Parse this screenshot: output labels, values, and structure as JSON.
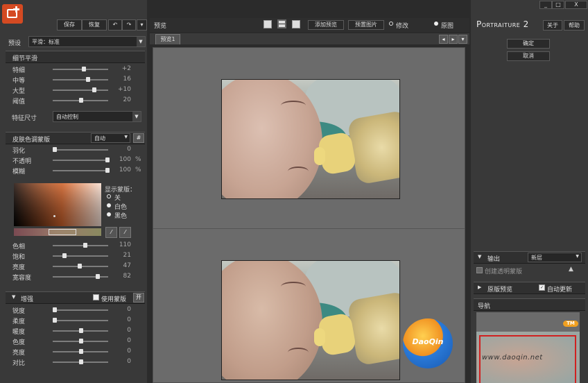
{
  "window": {
    "controls": [
      "_",
      "□",
      "X"
    ]
  },
  "toolbar": {
    "save": "保存",
    "restore": "恢复",
    "undo": "↶",
    "redo": "↷",
    "menu": "▾"
  },
  "preset": {
    "label": "预设",
    "value": "平滑：标准"
  },
  "detail": {
    "title": "细节平滑",
    "sliders": [
      {
        "label": "特细",
        "value": "+2",
        "pos": 0.55
      },
      {
        "label": "中等",
        "value": "16",
        "pos": 0.63
      },
      {
        "label": "大型",
        "value": "+10",
        "pos": 0.75
      },
      {
        "label": "阈值",
        "value": "20",
        "pos": 0.5
      }
    ],
    "feature_size_label": "特征尺寸",
    "feature_size_value": "自动控制"
  },
  "skin": {
    "title": "皮肤色调蒙版",
    "mode": "自动",
    "sliders": [
      {
        "label": "羽化",
        "value": "0",
        "unit": "",
        "pos": 0.0
      },
      {
        "label": "不透明",
        "value": "100",
        "unit": "%",
        "pos": 1.0
      },
      {
        "label": "模糊",
        "value": "100",
        "unit": "%",
        "pos": 1.0
      }
    ],
    "show_mask_label": "显示蒙版：",
    "mask_options": [
      {
        "label": "关",
        "selected": true
      },
      {
        "label": "白色",
        "selected": false
      },
      {
        "label": "黑色",
        "selected": false
      }
    ],
    "color_sliders": [
      {
        "label": "色相",
        "value": "110",
        "pos": 0.58
      },
      {
        "label": "饱和",
        "value": "21",
        "pos": 0.18
      },
      {
        "label": "亮度",
        "value": "47",
        "pos": 0.47
      },
      {
        "label": "宽容度",
        "value": "82",
        "pos": 0.82
      }
    ]
  },
  "enhance": {
    "title": "增强",
    "use_mask_label": "使用蒙版",
    "enable_label": "开",
    "sliders": [
      {
        "label": "锐度",
        "value": "0",
        "pos": 0.0
      },
      {
        "label": "柔度",
        "value": "0",
        "pos": 0.0
      },
      {
        "label": "暖度",
        "value": "0",
        "pos": 0.5
      },
      {
        "label": "色度",
        "value": "0",
        "pos": 0.5
      },
      {
        "label": "亮度",
        "value": "0",
        "pos": 0.5
      },
      {
        "label": "对比",
        "value": "0",
        "pos": 0.5
      }
    ]
  },
  "preview": {
    "label": "预览",
    "add_label": "添加预览",
    "source_label": "预置图片",
    "before_label": "修改",
    "after_label": "原图",
    "tab": "预览1"
  },
  "right": {
    "title": "Portraiture 2",
    "about": "关于",
    "help": "帮助",
    "ok": "确定",
    "cancel": "取消",
    "output_label": "输出",
    "output_value": "新层",
    "transparent_label": "创建透明蒙版",
    "preview_label": "原版预览",
    "auto_update_label": "自动更新",
    "navigator_label": "导航",
    "tm": "TM"
  },
  "watermark": {
    "logo": "DaoQin",
    "url": "www.daoqin.net"
  },
  "colors": {
    "accent": "#e0602a",
    "panel": "#393939",
    "canvas": "#6b6b6b"
  }
}
